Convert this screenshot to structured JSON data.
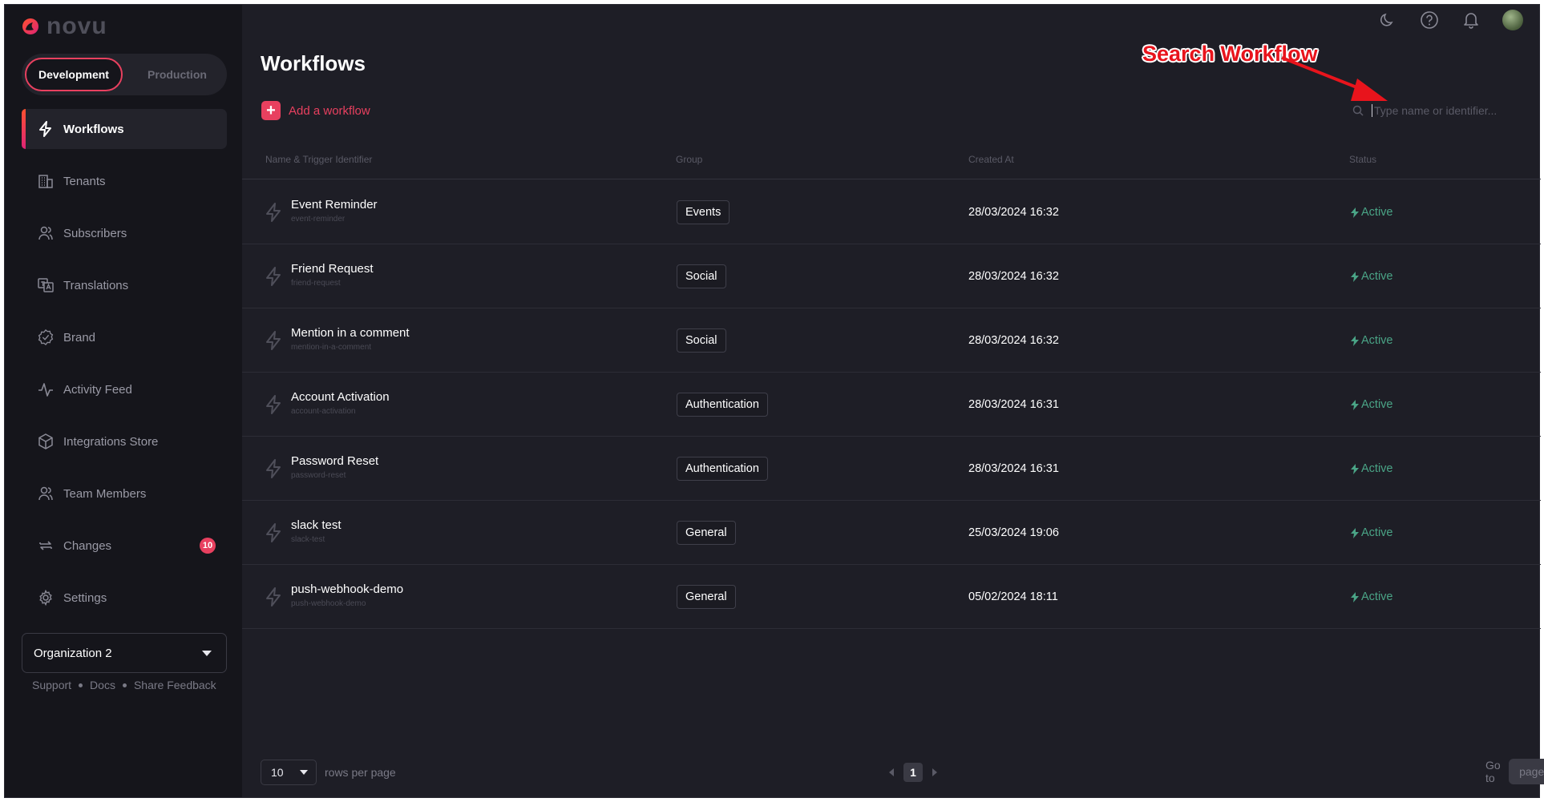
{
  "brand": {
    "name": "novu"
  },
  "environment": {
    "options": [
      "Development",
      "Production"
    ],
    "selected": "Development"
  },
  "sidebar": {
    "items": [
      {
        "label": "Workflows",
        "icon": "bolt-icon",
        "active": true
      },
      {
        "label": "Tenants",
        "icon": "building-icon"
      },
      {
        "label": "Subscribers",
        "icon": "users-icon"
      },
      {
        "label": "Translations",
        "icon": "translate-icon"
      },
      {
        "label": "Brand",
        "icon": "badge-check-icon"
      },
      {
        "label": "Activity Feed",
        "icon": "activity-icon"
      },
      {
        "label": "Integrations Store",
        "icon": "box-icon"
      },
      {
        "label": "Team Members",
        "icon": "team-icon"
      },
      {
        "label": "Changes",
        "icon": "sync-icon",
        "badge": "10"
      },
      {
        "label": "Settings",
        "icon": "gear-icon"
      }
    ],
    "organization": "Organization 2",
    "footer_links": [
      "Support",
      "Docs",
      "Share Feedback"
    ]
  },
  "header": {
    "icons": [
      "moon-icon",
      "help-icon",
      "bell-icon",
      "avatar"
    ]
  },
  "main": {
    "title": "Workflows",
    "add_label": "Add a workflow",
    "search_placeholder": "Type name or identifier...",
    "annotation": "Search Workflow",
    "columns": [
      "Name & Trigger Identifier",
      "Group",
      "Created At",
      "Status"
    ],
    "rows": [
      {
        "name": "Event Reminder",
        "identifier": "event-reminder",
        "group": "Events",
        "created": "28/03/2024 16:32",
        "status": "Active"
      },
      {
        "name": "Friend Request",
        "identifier": "friend-request",
        "group": "Social",
        "created": "28/03/2024 16:32",
        "status": "Active"
      },
      {
        "name": "Mention in a comment",
        "identifier": "mention-in-a-comment",
        "group": "Social",
        "created": "28/03/2024 16:32",
        "status": "Active"
      },
      {
        "name": "Account Activation",
        "identifier": "account-activation",
        "group": "Authentication",
        "created": "28/03/2024 16:31",
        "status": "Active"
      },
      {
        "name": "Password Reset",
        "identifier": "password-reset",
        "group": "Authentication",
        "created": "28/03/2024 16:31",
        "status": "Active"
      },
      {
        "name": "slack test",
        "identifier": "slack-test",
        "group": "General",
        "created": "25/03/2024 19:06",
        "status": "Active"
      },
      {
        "name": "push-webhook-demo",
        "identifier": "push-webhook-demo",
        "group": "General",
        "created": "05/02/2024 18:11",
        "status": "Active"
      }
    ]
  },
  "pagination": {
    "rows_per_page": "10",
    "rows_per_page_label": "rows per page",
    "current_page": "1",
    "goto_label": "Go to",
    "goto_placeholder": "page"
  },
  "colors": {
    "accent": "#e8405f",
    "status_active": "#4aa486",
    "background": "#1e1e26",
    "sidebar": "#15151b"
  }
}
